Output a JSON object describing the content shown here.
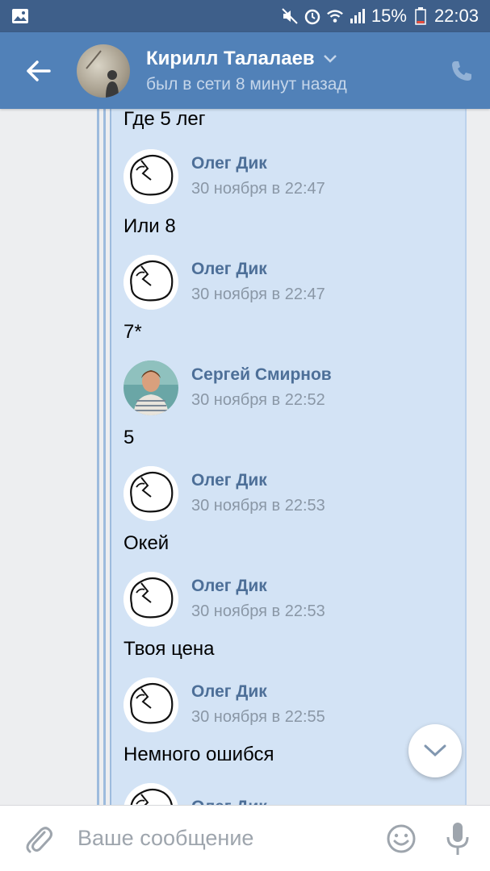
{
  "status_bar": {
    "battery": "15%",
    "time": "22:03",
    "icons": [
      "gallery-icon",
      "mute-icon",
      "alarm-icon",
      "wifi-icon",
      "signal-icon",
      "battery-icon"
    ]
  },
  "header": {
    "name": "Кирилл Талалаев",
    "status": "был в сети 8 минут назад"
  },
  "chat": {
    "first_text": "Где 5 лег",
    "messages": [
      {
        "author": "Олег Дик",
        "date": "30 ноября в 22:47",
        "text": "Или 8",
        "avatar": "oleg"
      },
      {
        "author": "Олег Дик",
        "date": "30 ноября в 22:47",
        "text": "7*",
        "avatar": "oleg"
      },
      {
        "author": "Сергей Смирнов",
        "date": "30 ноября в 22:52",
        "text": "5",
        "avatar": "sergey"
      },
      {
        "author": "Олег Дик",
        "date": "30 ноября в 22:53",
        "text": "Окей",
        "avatar": "oleg"
      },
      {
        "author": "Олег Дик",
        "date": "30 ноября в 22:53",
        "text": "Твоя цена",
        "avatar": "oleg"
      },
      {
        "author": "Олег Дик",
        "date": "30 ноября в 22:55",
        "text": "Немного ошибся",
        "avatar": "oleg"
      },
      {
        "author": "Олег Дик",
        "date": "",
        "text": "",
        "avatar": "oleg"
      }
    ]
  },
  "input": {
    "placeholder": "Ваше сообщение"
  },
  "colors": {
    "header": "#5181b8",
    "status_bar": "#3e5f8a",
    "quote_bg": "#d3e3f5",
    "author": "#4d6f98"
  }
}
